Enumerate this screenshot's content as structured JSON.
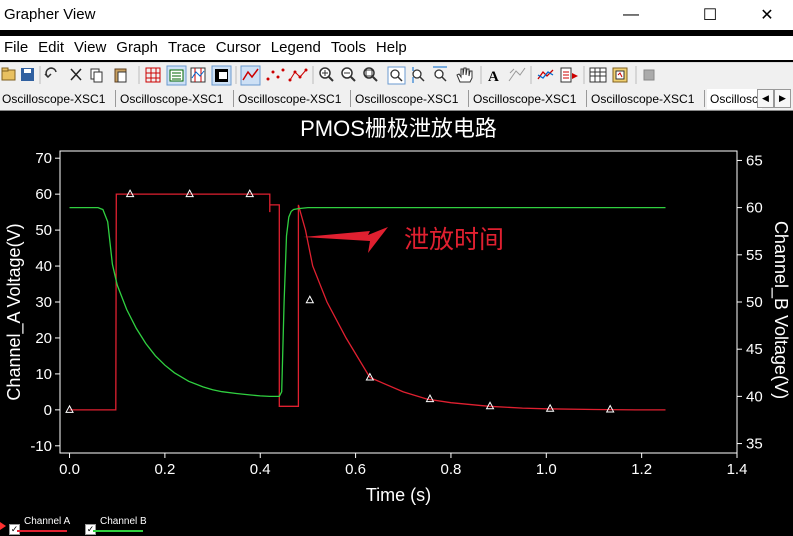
{
  "window": {
    "title": "Grapher View",
    "minimize": "—",
    "maximize": "☐",
    "close": "✕"
  },
  "menu": [
    "File",
    "Edit",
    "View",
    "Graph",
    "Trace",
    "Cursor",
    "Legend",
    "Tools",
    "Help"
  ],
  "toolbar_icons": [
    "folder-open-icon",
    "save-icon",
    "undo-icon",
    "cut-icon",
    "copy-icon",
    "paste-icon",
    "grid-icon",
    "legend-icon",
    "cursors-icon",
    "invert-colors-icon",
    "show-lines-icon",
    "show-points-icon",
    "show-lines-points-icon",
    "zoom-in-icon",
    "zoom-out-icon",
    "zoom-fit-icon",
    "zoom-x-icon",
    "zoom-y-icon",
    "pan-icon",
    "title-icon",
    "label-icon",
    "merge-icon",
    "select-trace-icon",
    "export-icon",
    "properties-icon",
    "stop-icon"
  ],
  "tabs": [
    "Oscilloscope-XSC1",
    "Oscilloscope-XSC1",
    "Oscilloscope-XSC1",
    "Oscilloscope-XSC1",
    "Oscilloscope-XSC1",
    "Oscilloscope-XSC1",
    "Oscillosc"
  ],
  "tab_arrows": [
    "◀",
    "▶"
  ],
  "chart_data": {
    "type": "line",
    "title": "PMOS栅极泄放电路",
    "xlabel": "Time (s)",
    "ylabel_left": "Channel_A Voltage(V)",
    "ylabel_right": "Channel_B Voltage(V)",
    "xlim": [
      -0.02,
      1.4
    ],
    "ylim_left": [
      -12,
      72
    ],
    "ylim_right": [
      34,
      66
    ],
    "xticks": [
      "0.0",
      "0.2",
      "0.4",
      "0.6",
      "0.8",
      "1.0",
      "1.2",
      "1.4"
    ],
    "yticks_left": [
      "-10",
      "0",
      "10",
      "20",
      "30",
      "40",
      "50",
      "60",
      "70"
    ],
    "yticks_right": [
      "35",
      "40",
      "45",
      "50",
      "55",
      "60",
      "65"
    ],
    "series": [
      {
        "name": "Channel A",
        "color": "#e02030",
        "axis": "left",
        "x": [
          0.0,
          0.068,
          0.069,
          0.07,
          0.071,
          0.072,
          0.073,
          0.074,
          0.075,
          0.076,
          0.077,
          0.078,
          0.079,
          0.08,
          0.081,
          0.082,
          0.083,
          0.084,
          0.085,
          0.086,
          0.087,
          0.088,
          0.089,
          0.09,
          0.091,
          0.092,
          0.093,
          0.094,
          0.095,
          0.096,
          0.097,
          0.098,
          0.099,
          0.1,
          0.42,
          0.42,
          0.42,
          0.44,
          0.44,
          0.44,
          0.44,
          0.48,
          0.48,
          0.48,
          0.48,
          0.48,
          0.495,
          0.51,
          0.54,
          0.58,
          0.63,
          0.7,
          0.75,
          0.8,
          0.88,
          0.95,
          1.0,
          1.1,
          1.2,
          1.25
        ],
        "y": [
          0,
          0,
          0,
          0,
          0,
          0,
          0,
          0,
          0,
          0,
          0,
          0,
          0,
          0,
          0,
          0,
          0,
          0,
          0,
          0,
          0,
          0,
          0,
          0,
          0,
          0,
          0,
          0,
          0,
          0,
          0,
          60,
          60,
          60,
          60,
          55,
          57,
          57,
          1,
          1,
          1,
          1,
          57,
          57,
          57,
          57,
          50,
          40,
          30,
          20,
          9,
          5,
          3,
          2,
          1,
          0.5,
          0.3,
          0.1,
          0,
          0
        ]
      },
      {
        "name": "Channel B",
        "color": "#30d040",
        "axis": "right",
        "x": [
          0.0,
          0.06,
          0.065,
          0.07,
          0.08,
          0.09,
          0.1,
          0.12,
          0.14,
          0.16,
          0.18,
          0.2,
          0.22,
          0.25,
          0.28,
          0.3,
          0.32,
          0.35,
          0.38,
          0.4,
          0.42,
          0.43,
          0.44,
          0.445,
          0.45,
          0.455,
          0.46,
          0.465,
          0.47,
          0.48,
          0.5,
          0.55,
          0.6,
          0.8,
          1.0,
          1.2,
          1.25
        ],
        "y": [
          60,
          60,
          59.9,
          59.8,
          58.5,
          54,
          51.8,
          49.2,
          47.2,
          45.6,
          44.3,
          43.3,
          42.5,
          41.6,
          41.0,
          40.7,
          40.5,
          40.3,
          40.15,
          40.05,
          40.0,
          40.0,
          40.0,
          40.5,
          50,
          57,
          59,
          59.6,
          59.8,
          59.9,
          60,
          60,
          60,
          60,
          60,
          60,
          60
        ]
      }
    ],
    "markers_A": {
      "x": [
        0.0,
        0.127,
        0.252,
        0.378,
        0.504,
        0.63,
        0.756,
        0.882,
        1.008,
        1.134
      ],
      "y": [
        0,
        60,
        60,
        60,
        30.5,
        9,
        3,
        1,
        0.3,
        0.1
      ]
    },
    "annotation": {
      "text": "泄放时间",
      "arrow": "pointing left to the green rising edge near t≈0.48 s",
      "color": "#e02030"
    },
    "legend": [
      "Channel A",
      "Channel B"
    ],
    "background": "#000000",
    "axis_color": "#ffffff"
  }
}
